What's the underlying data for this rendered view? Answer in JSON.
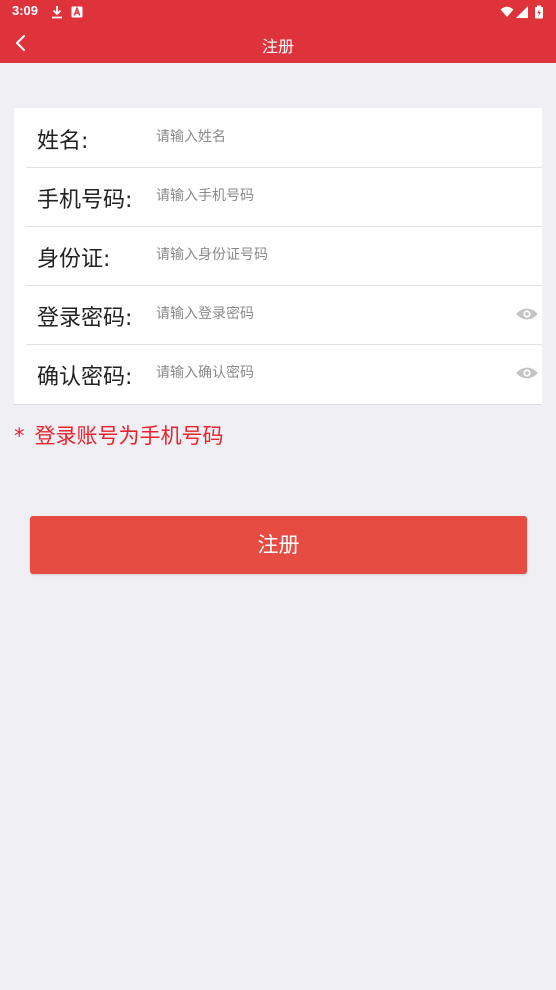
{
  "status_bar": {
    "time": "3:09",
    "icons": [
      "download-icon",
      "notification-a-icon",
      "wifi-icon",
      "signal-icon",
      "battery-icon"
    ]
  },
  "app_bar": {
    "title": "注册",
    "back_icon": "chevron-left-icon"
  },
  "form": {
    "rows": [
      {
        "label": "姓名:",
        "placeholder": "请输入姓名",
        "value": ""
      },
      {
        "label": "手机号码:",
        "placeholder": "请输入手机号码",
        "value": ""
      },
      {
        "label": "身份证:",
        "placeholder": "请输入身份证号码",
        "value": ""
      },
      {
        "label": "登录密码:",
        "placeholder": "请输入登录密码",
        "value": "",
        "icon": "eye-icon"
      },
      {
        "label": "确认密码:",
        "placeholder": "请输入确认密码",
        "value": "",
        "icon": "eye-icon"
      }
    ]
  },
  "note": {
    "star": "*",
    "text": "登录账号为手机号码"
  },
  "submit": {
    "label": "注册"
  },
  "colors": {
    "header": "#de333b",
    "background": "#efeff4",
    "button": "#e74c43",
    "note": "#e8232d"
  }
}
